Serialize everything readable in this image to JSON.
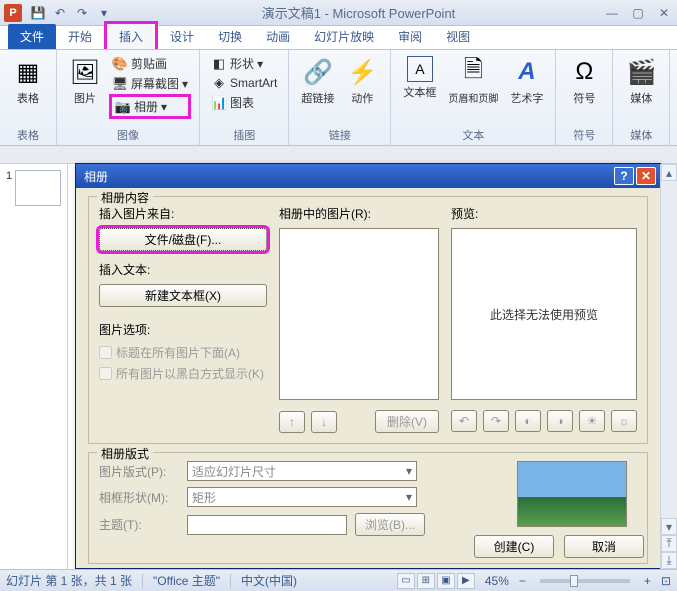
{
  "app": {
    "icon_letter": "P",
    "title": "演示文稿1 - Microsoft PowerPoint"
  },
  "tabs": {
    "file": "文件",
    "home": "开始",
    "insert": "插入",
    "design": "设计",
    "transitions": "切换",
    "animations": "动画",
    "slideshow": "幻灯片放映",
    "review": "审阅",
    "view": "视图"
  },
  "ribbon": {
    "tables": {
      "label": "表格",
      "btn": "表格"
    },
    "images": {
      "label": "图像",
      "picture": "图片",
      "clipart": "剪贴画",
      "screenshot": "屏幕截图",
      "album": "相册"
    },
    "illustrations": {
      "label": "插图",
      "shapes": "形状",
      "smartart": "SmartArt",
      "chart": "图表"
    },
    "links": {
      "label": "链接",
      "hyperlink": "超链接",
      "action": "动作"
    },
    "text": {
      "label": "文本",
      "textbox": "文本框",
      "hf": "页眉和页脚",
      "wordart": "艺术字"
    },
    "symbols": {
      "label": "符号",
      "symbol": "符号"
    },
    "media": {
      "label": "媒体",
      "media": "媒体"
    }
  },
  "thumb": {
    "num": "1"
  },
  "dialog": {
    "title": "相册",
    "content_legend": "相册内容",
    "layout_legend": "相册版式",
    "insert_from": "插入图片来自:",
    "file_disk": "文件/磁盘(F)...",
    "insert_text": "插入文本:",
    "new_textbox": "新建文本框(X)",
    "pic_options": "图片选项:",
    "opt_caption": "标题在所有图片下面(A)",
    "opt_bw": "所有图片以黑白方式显示(K)",
    "pics_in_album": "相册中的图片(R):",
    "preview": "预览:",
    "preview_msg": "此选择无法使用预览",
    "remove": "删除(V)",
    "pic_layout": "图片版式(P):",
    "pic_layout_val": "适应幻灯片尺寸",
    "frame_shape": "相框形状(M):",
    "frame_shape_val": "矩形",
    "theme": "主题(T):",
    "browse": "浏览(B)...",
    "create": "创建(C)",
    "cancel": "取消"
  },
  "status": {
    "slide": "幻灯片 第 1 张，共 1 张",
    "theme": "\"Office 主题\"",
    "lang": "中文(中国)",
    "zoom": "45%"
  }
}
